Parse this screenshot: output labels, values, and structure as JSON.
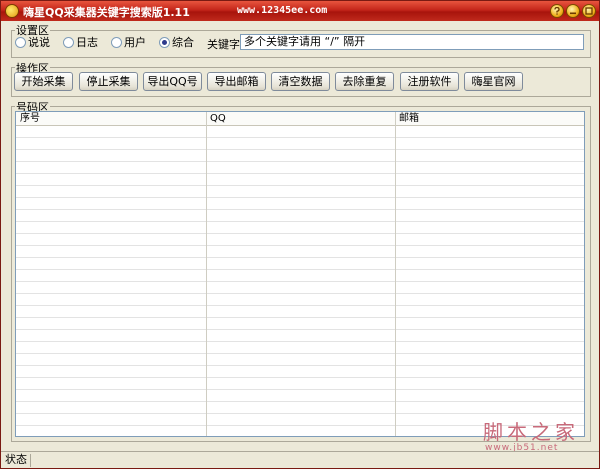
{
  "window": {
    "title": "嗨星QQ采集器关键字搜索版1.11",
    "url": "www.12345ee.com"
  },
  "settings": {
    "group_label": "设置区",
    "radios": [
      {
        "label": "说说",
        "checked": false
      },
      {
        "label": "日志",
        "checked": false
      },
      {
        "label": "用户",
        "checked": false
      },
      {
        "label": "综合",
        "checked": true
      }
    ],
    "keyword_label": "关键字:",
    "keyword_value": "多个关键字请用 “/” 隔开"
  },
  "operations": {
    "group_label": "操作区",
    "buttons": [
      {
        "label": "开始采集"
      },
      {
        "label": "停止采集"
      },
      {
        "label": "导出QQ号"
      },
      {
        "label": "导出邮箱"
      },
      {
        "label": "清空数据"
      },
      {
        "label": "去除重复"
      },
      {
        "label": "注册软件"
      },
      {
        "label": "嗨星官网"
      }
    ]
  },
  "numbers": {
    "group_label": "号码区",
    "columns": [
      "序号",
      "QQ",
      "邮箱"
    ]
  },
  "status": {
    "label": "状态"
  },
  "watermark": {
    "main": "脚本之家",
    "sub": "www.jb51.net"
  },
  "colors": {
    "titlebar": "#c4261a",
    "window_bg": "#ece9d8",
    "watermark": "#c86a7a"
  }
}
